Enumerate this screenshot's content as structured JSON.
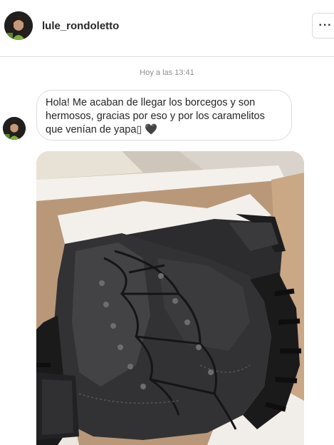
{
  "header": {
    "username": "lule_rondoletto",
    "avatar_icon": "profile-avatar-icon",
    "more_label": "···",
    "more_icon": "more-options-icon"
  },
  "conversation": {
    "timestamp": "Hoy a las 13:41",
    "message": {
      "text": "Hola! Me acaban de llegar los borcegos y son hermosos, gracias por eso y por los caramelitos que venían de yapa▯ 🖤",
      "avatar_icon": "sender-avatar-icon"
    },
    "attachment": {
      "type": "photo",
      "icon": "boots-in-box-photo"
    }
  },
  "colors": {
    "border": "#dbdbdb",
    "text": "#262626",
    "muted": "#8e8e8e",
    "background": "#ffffff"
  }
}
